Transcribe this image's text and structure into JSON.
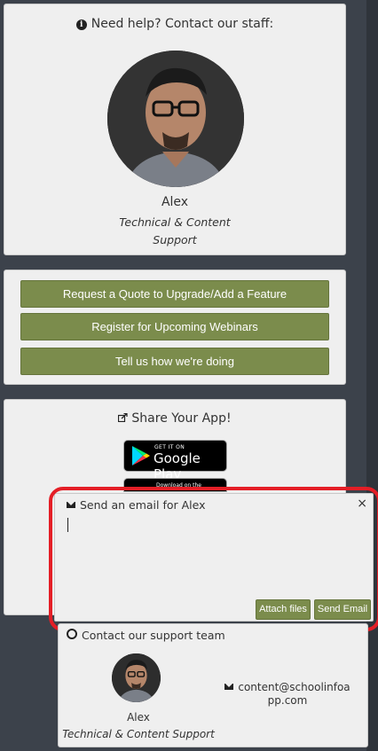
{
  "help": {
    "title": "Need help? Contact our staff:",
    "name": "Alex",
    "role": "Technical & Content Support"
  },
  "actions": {
    "quote": "Request a Quote to Upgrade/Add a Feature",
    "webinar": "Register for Upcoming Webinars",
    "feedback": "Tell us how we're doing"
  },
  "share": {
    "title": "Share Your App!",
    "google_small": "GET IT ON",
    "google_big": "Google Play",
    "apple_small": "Download on the"
  },
  "email": {
    "title": "Send an email for Alex",
    "close": "×",
    "body_value": "",
    "attach": "Attach files",
    "send": "Send Email"
  },
  "contact": {
    "title": "Contact our support team",
    "name": "Alex",
    "role": "Technical & Content Support",
    "email": "content@schoolinfoapp.com"
  },
  "colors": {
    "button": "#7b8c4c",
    "background": "#3c424b",
    "card": "#efefef",
    "highlight": "#e41e26"
  }
}
